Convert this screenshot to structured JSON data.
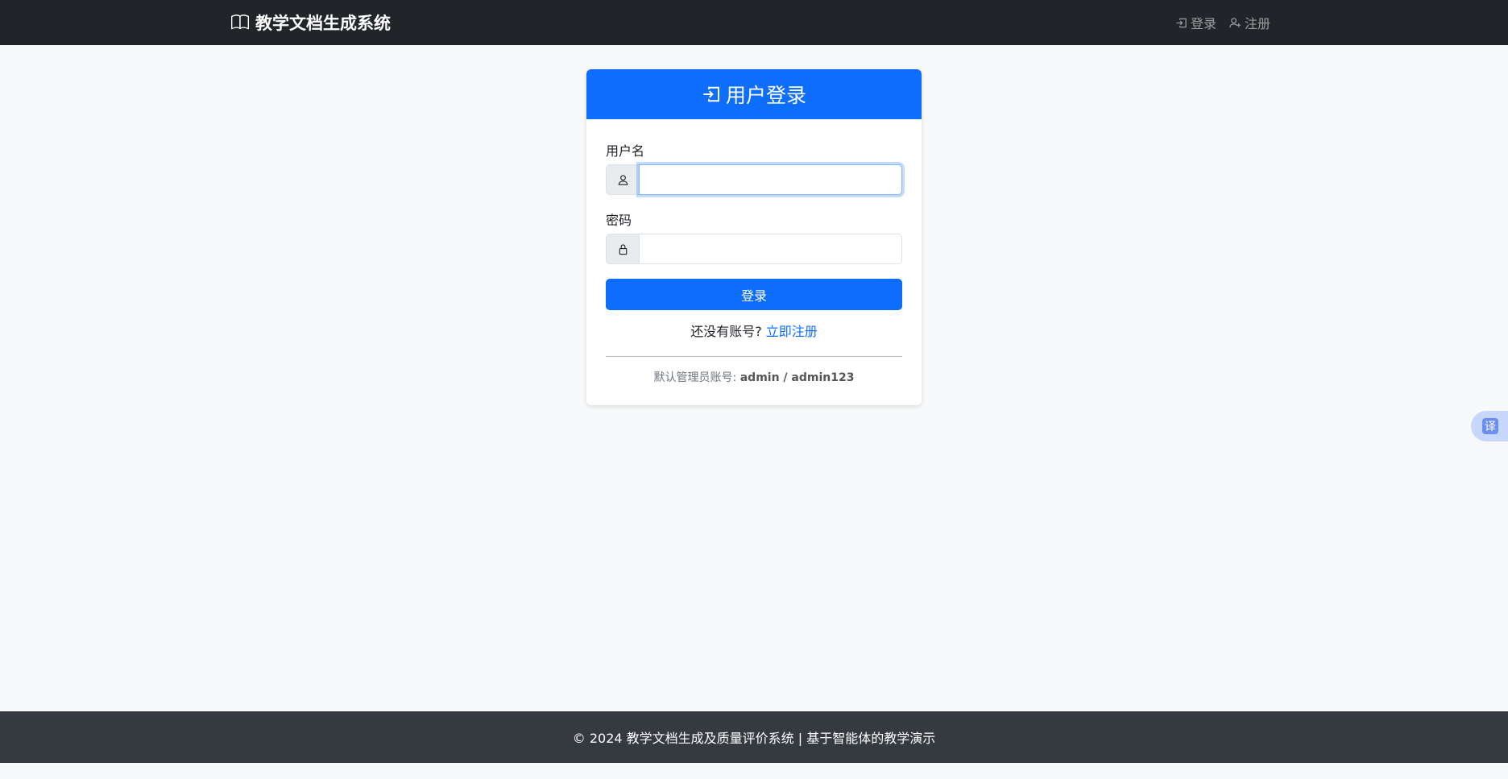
{
  "navbar": {
    "brand_icon": "book-icon",
    "brand": "教学文档生成系统",
    "links": [
      {
        "icon": "login-icon",
        "label": "登录"
      },
      {
        "icon": "person-add-icon",
        "label": "注册"
      }
    ]
  },
  "login_card": {
    "header_icon": "login-icon",
    "title": "用户登录",
    "username": {
      "label": "用户名",
      "icon": "person-icon",
      "value": ""
    },
    "password": {
      "label": "密码",
      "icon": "lock-icon",
      "value": ""
    },
    "submit_label": "登录",
    "register_prompt": "还没有账号?",
    "register_link": "立即注册",
    "default_account_label": "默认管理员账号:",
    "default_account_value": "admin / admin123"
  },
  "translate_button": {
    "label": "译"
  },
  "footer": {
    "text": "© 2024 教学文档生成及质量评价系统 | 基于智能体的教学演示"
  },
  "colors": {
    "navbar_bg": "#212529",
    "primary": "#0d6efd",
    "page_bg": "#f8f9fa",
    "footer_bg": "#343a40"
  }
}
